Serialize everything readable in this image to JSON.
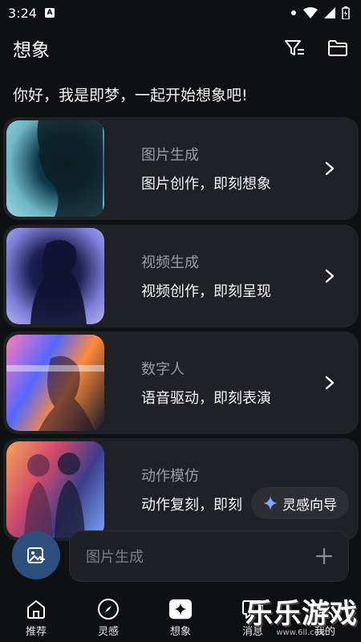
{
  "status_bar": {
    "time": "3:24",
    "badge": "A"
  },
  "header": {
    "title": "想象",
    "filter_icon": "filter-icon",
    "folder_icon": "folder-icon"
  },
  "greeting": "你好，我是即梦，一起开始想象吧!",
  "cards": [
    {
      "title": "图片生成",
      "subtitle": "图片创作，即刻想象"
    },
    {
      "title": "视频生成",
      "subtitle": "视频创作，即刻呈现"
    },
    {
      "title": "数字人",
      "subtitle": "语音驱动，即刻表演"
    },
    {
      "title": "动作模仿",
      "subtitle": "动作复刻，即刻"
    }
  ],
  "inspiration_button": "灵感向导",
  "input": {
    "placeholder": "图片生成"
  },
  "nav": [
    {
      "label": "推荐",
      "icon": "home-icon"
    },
    {
      "label": "灵感",
      "icon": "compass-icon"
    },
    {
      "label": "想象",
      "icon": "sparkle-icon"
    },
    {
      "label": "消息",
      "icon": "message-icon"
    },
    {
      "label": "我的",
      "icon": "profile-icon"
    }
  ],
  "watermark": {
    "main": "乐乐游戏",
    "sub": "www.6ll.com"
  },
  "colors": {
    "background": "#0f1012",
    "card": "#1f2126",
    "accent": "#2d4f7e"
  }
}
